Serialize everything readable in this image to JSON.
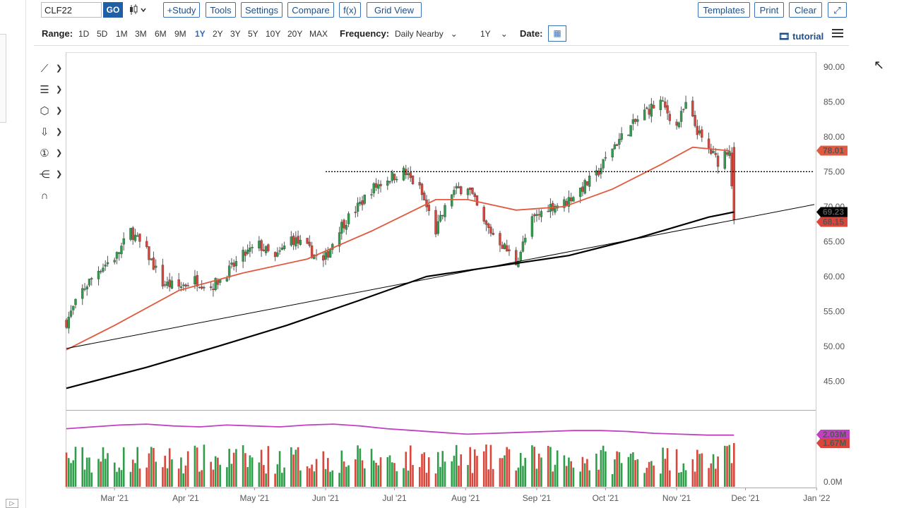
{
  "toolbar": {
    "symbol": "CLF22",
    "go_label": "GO",
    "chart_type_icon": "candlestick-icon",
    "study_label": "+Study",
    "tools_label": "Tools",
    "settings_label": "Settings",
    "compare_label": "Compare",
    "fx_label": "f(x)",
    "grid_view_label": "Grid View",
    "templates_label": "Templates",
    "print_label": "Print",
    "clear_label": "Clear",
    "expand_icon": "expand-icon"
  },
  "rangebar": {
    "range_label": "Range:",
    "ranges": [
      "1D",
      "5D",
      "1M",
      "3M",
      "6M",
      "9M",
      "1Y",
      "2Y",
      "3Y",
      "5Y",
      "10Y",
      "20Y",
      "MAX"
    ],
    "active_range": "1Y",
    "frequency_label": "Frequency:",
    "frequency_value": "Daily Nearby",
    "period_value": "1Y",
    "date_label": "Date:",
    "calendar_icon": "calendar-icon",
    "tutorial_label": "tutorial"
  },
  "drawing_tools": [
    "line-tool-icon",
    "fibonacci-tool-icon",
    "shape-tool-icon",
    "arrow-tool-icon",
    "annotation-tool-icon",
    "measure-tool-icon",
    "magnet-tool-icon"
  ],
  "colors": {
    "up": "#2e9e4a",
    "down": "#d9463b",
    "ma50": "#e05a3f",
    "ma200": "#000000",
    "volume_avg": "#c040c0",
    "accent": "#1f5fa5"
  },
  "chart_data": {
    "type": "candlestick",
    "symbol": "CLF22",
    "frequency": "Daily Nearby",
    "x_tick_labels": [
      "Mar '21",
      "Apr '21",
      "May '21",
      "Jun '21",
      "Jul '21",
      "Aug '21",
      "Sep '21",
      "Oct '21",
      "Nov '21",
      "Dec '21",
      "Jan '22"
    ],
    "y_tick_labels": [
      "90.00",
      "85.00",
      "80.00",
      "75.00",
      "70.00",
      "65.00",
      "60.00",
      "55.00",
      "50.00",
      "45.00"
    ],
    "ylim": [
      41.0,
      92.0
    ],
    "volume_tick_labels": [
      "0.0M"
    ],
    "price_path": [
      [
        "2021-02-08",
        53.5
      ],
      [
        "2021-02-15",
        58.0
      ],
      [
        "2021-02-22",
        61.0
      ],
      [
        "2021-03-02",
        63.0
      ],
      [
        "2021-03-08",
        66.5
      ],
      [
        "2021-03-15",
        63.5
      ],
      [
        "2021-03-22",
        59.0
      ],
      [
        "2021-03-29",
        58.5
      ],
      [
        "2021-04-05",
        59.5
      ],
      [
        "2021-04-12",
        58.5
      ],
      [
        "2021-04-19",
        60.5
      ],
      [
        "2021-04-26",
        63.0
      ],
      [
        "2021-05-03",
        64.5
      ],
      [
        "2021-05-10",
        62.5
      ],
      [
        "2021-05-17",
        65.5
      ],
      [
        "2021-05-24",
        64.0
      ],
      [
        "2021-05-31",
        62.0
      ],
      [
        "2021-06-07",
        67.0
      ],
      [
        "2021-06-14",
        69.5
      ],
      [
        "2021-06-21",
        72.5
      ],
      [
        "2021-06-28",
        74.0
      ],
      [
        "2021-07-05",
        75.0
      ],
      [
        "2021-07-12",
        72.5
      ],
      [
        "2021-07-19",
        66.5
      ],
      [
        "2021-07-26",
        72.0
      ],
      [
        "2021-08-02",
        73.0
      ],
      [
        "2021-08-09",
        67.5
      ],
      [
        "2021-08-16",
        65.0
      ],
      [
        "2021-08-23",
        62.0
      ],
      [
        "2021-08-30",
        68.0
      ],
      [
        "2021-09-06",
        70.0
      ],
      [
        "2021-09-13",
        70.5
      ],
      [
        "2021-09-20",
        72.5
      ],
      [
        "2021-09-27",
        74.5
      ],
      [
        "2021-10-04",
        78.5
      ],
      [
        "2021-10-11",
        81.0
      ],
      [
        "2021-10-18",
        83.5
      ],
      [
        "2021-10-25",
        85.0
      ],
      [
        "2021-11-01",
        81.5
      ],
      [
        "2021-11-05",
        84.5
      ],
      [
        "2021-11-12",
        79.5
      ],
      [
        "2021-11-19",
        76.5
      ],
      [
        "2021-11-24",
        78.5
      ],
      [
        "2021-11-26",
        68.15
      ]
    ],
    "ma50_path": [
      [
        "2021-02-08",
        49.5
      ],
      [
        "2021-03-01",
        53.0
      ],
      [
        "2021-03-29",
        58.0
      ],
      [
        "2021-04-26",
        60.5
      ],
      [
        "2021-05-24",
        62.5
      ],
      [
        "2021-06-21",
        66.5
      ],
      [
        "2021-07-19",
        71.0
      ],
      [
        "2021-08-02",
        71.0
      ],
      [
        "2021-08-23",
        69.5
      ],
      [
        "2021-09-13",
        70.0
      ],
      [
        "2021-10-04",
        72.5
      ],
      [
        "2021-10-25",
        76.0
      ],
      [
        "2021-11-08",
        78.5
      ],
      [
        "2021-11-24",
        78.0
      ]
    ],
    "ma200_path": [
      [
        "2021-02-08",
        44.0
      ],
      [
        "2021-03-15",
        47.0
      ],
      [
        "2021-04-15",
        50.0
      ],
      [
        "2021-05-15",
        53.0
      ],
      [
        "2021-06-15",
        56.5
      ],
      [
        "2021-07-15",
        60.0
      ],
      [
        "2021-08-15",
        61.5
      ],
      [
        "2021-09-15",
        63.0
      ],
      [
        "2021-10-15",
        65.5
      ],
      [
        "2021-11-15",
        68.5
      ],
      [
        "2021-11-26",
        69.23
      ]
    ],
    "resistance_line": {
      "start": "2021-06-01",
      "end": "2021-12-31",
      "value": 75.0
    },
    "trend_line": {
      "start": [
        "2021-02-08",
        49.7
      ],
      "end": [
        "2021-12-31",
        70.3
      ]
    },
    "last_price_labels": [
      {
        "text": "78.01",
        "value": 78.01,
        "color": "#e05a3f"
      },
      {
        "text": "69.23",
        "value": 69.23,
        "color": "#000000"
      },
      {
        "text": "68.15",
        "value": 68.15,
        "color": "#d9463b"
      }
    ],
    "volume_labels": [
      {
        "text": "2.03M",
        "color": "#c040c0"
      },
      {
        "text": "1.67M",
        "color": "#d9463b"
      }
    ],
    "volume_avg_path": [
      0.68,
      0.7,
      0.72,
      0.73,
      0.71,
      0.7,
      0.72,
      0.71,
      0.7,
      0.72,
      0.73,
      0.71,
      0.68,
      0.66,
      0.64,
      0.62,
      0.63,
      0.64,
      0.65,
      0.66,
      0.66,
      0.65,
      0.63,
      0.62,
      0.61,
      0.61
    ]
  }
}
